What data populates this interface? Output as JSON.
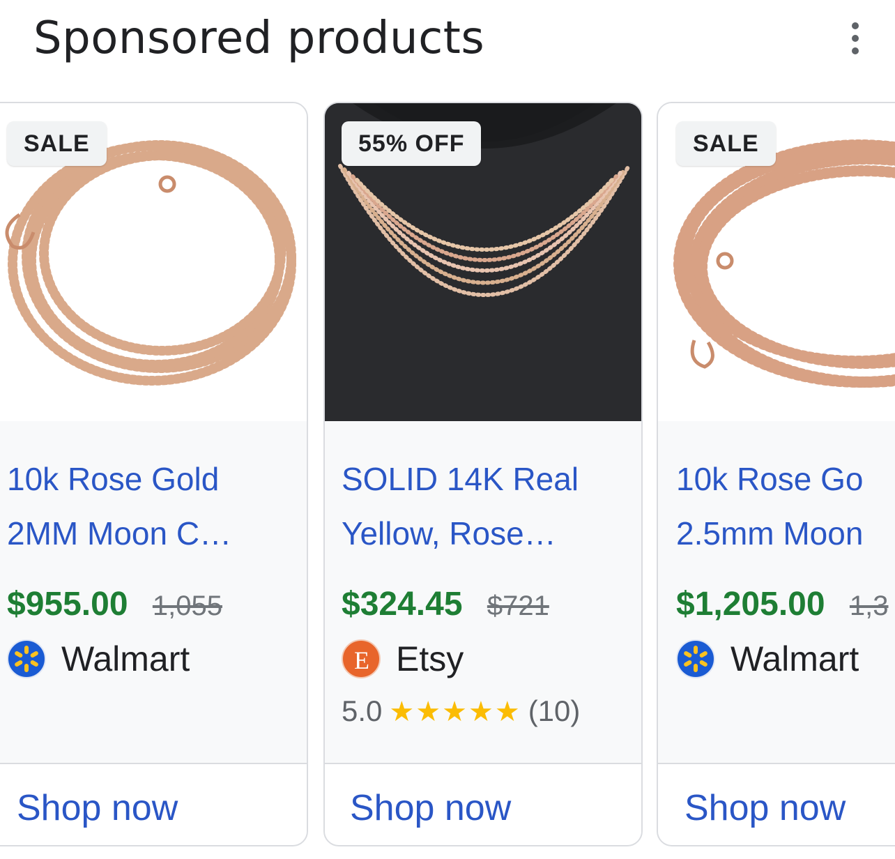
{
  "header": {
    "title": "Sponsored products",
    "menu_icon": "more-vert-icon"
  },
  "products": [
    {
      "badge": "SALE",
      "title_line1": "10k Rose Gold",
      "title_line2": "2MM Moon C…",
      "price": "$955.00",
      "old_price": "1,055",
      "merchant": "Walmart",
      "merchant_icon": "walmart-spark-icon",
      "cta": "Shop now"
    },
    {
      "badge": "55% OFF",
      "title_line1": "SOLID 14K Real",
      "title_line2": "Yellow, Rose…",
      "price": "$324.45",
      "old_price": "$721",
      "merchant": "Etsy",
      "merchant_icon": "etsy-e-icon",
      "rating_value": "5.0",
      "stars": "★★★★★",
      "rating_count": "(10)",
      "cta": "Shop now"
    },
    {
      "badge": "SALE",
      "title_line1": "10k Rose Go",
      "title_line2": "2.5mm Moon",
      "price": "$1,205.00",
      "old_price": "1,3",
      "merchant": "Walmart",
      "merchant_icon": "walmart-spark-icon",
      "cta": "Shop now"
    }
  ],
  "colors": {
    "link": "#2a56c6",
    "price": "#1e7e34",
    "star": "#fbbc04",
    "walmart": "#1a5bd3",
    "etsy": "#e8652b"
  }
}
